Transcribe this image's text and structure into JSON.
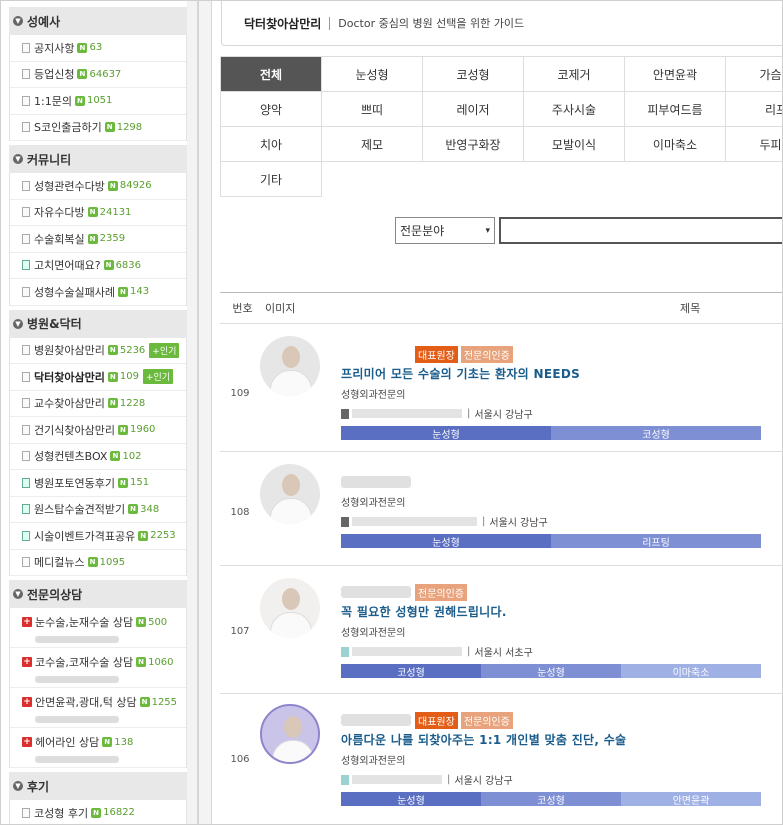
{
  "sidebar": {
    "sections": [
      {
        "title": "성예사",
        "items": [
          {
            "label": "공지사항",
            "count": "63"
          },
          {
            "label": "등업신청",
            "count": "64637"
          },
          {
            "label": "1:1문의",
            "count": "1051"
          },
          {
            "label": "S코인출금하기",
            "count": "1298"
          }
        ]
      },
      {
        "title": "커뮤니티",
        "items": [
          {
            "label": "성형관련수다방",
            "count": "84926"
          },
          {
            "label": "자유수다방",
            "count": "24131"
          },
          {
            "label": "수술회복실",
            "count": "2359"
          },
          {
            "label": "고치면어때요?",
            "count": "6836"
          },
          {
            "label": "성형수술실패사례",
            "count": "143"
          }
        ]
      },
      {
        "title": "병원&닥터",
        "items": [
          {
            "label": "병원찾아삼만리",
            "count": "5236",
            "hot": "+인기"
          },
          {
            "label": "닥터찾아삼만리",
            "count": "109",
            "hot": "+인기"
          },
          {
            "label": "교수찾아삼만리",
            "count": "1228"
          },
          {
            "label": "건기식찾아삼만리",
            "count": "1960"
          },
          {
            "label": "성형컨텐츠BOX",
            "count": "102"
          },
          {
            "label": "병원포토연동후기",
            "count": "151"
          },
          {
            "label": "원스탑수술견적받기",
            "count": "348"
          },
          {
            "label": "시술이벤트가격표공유",
            "count": "2253"
          },
          {
            "label": "메디컬뉴스",
            "count": "1095"
          }
        ]
      },
      {
        "title": "전문의상담",
        "items": [
          {
            "label": "눈수술,눈재수술 상담",
            "count": "500"
          },
          {
            "label": "코수술,코재수술 상담",
            "count": "1060"
          },
          {
            "label": "안면윤곽,광대,턱 상담",
            "count": "1255"
          },
          {
            "label": "헤어라인 상담",
            "count": "138"
          }
        ]
      },
      {
        "title": "후기",
        "items": [
          {
            "label": "코성형 후기",
            "count": "16822"
          }
        ]
      }
    ]
  },
  "header": {
    "title": "닥터찾아삼만리",
    "subtitle": "Doctor 중심의 병원 선택을 위한 가이드"
  },
  "categories": [
    "전체",
    "눈성형",
    "코성형",
    "코제거",
    "안면윤곽",
    "가슴성",
    "양악",
    "쁘띠",
    "레이저",
    "주사시술",
    "피부여드름",
    "리프",
    "치아",
    "제모",
    "반영구화장",
    "모발이식",
    "이마축소",
    "두피문",
    "기타"
  ],
  "search": {
    "select_value": "전문분야",
    "arrow": "▾"
  },
  "table_header": {
    "num": "번호",
    "image": "이미지",
    "title": "제목"
  },
  "rows": [
    {
      "num": "109",
      "tags": [
        "대표원장",
        "전문의인증"
      ],
      "title": "프리미어 모든 수술의 기초는 환자의 NEEDS",
      "dept": "성형외과전문의",
      "location": "서울시 강남구",
      "specialties": [
        "눈성형",
        "코성형"
      ]
    },
    {
      "num": "108",
      "tags": [],
      "title": "",
      "dept": "성형외과전문의",
      "location": "서울시 강남구",
      "specialties": [
        "눈성형",
        "리프팅"
      ]
    },
    {
      "num": "107",
      "tags": [
        "전문의인증"
      ],
      "title": "꼭 필요한 성형만 권해드립니다.",
      "dept": "성형외과전문의",
      "location": "서울시 서초구",
      "specialties": [
        "코성형",
        "눈성형",
        "이마축소"
      ]
    },
    {
      "num": "106",
      "tags": [
        "대표원장",
        "전문의인증"
      ],
      "title": "아름다운 나를 되찾아주는 1:1 개인별 맞춤 진단, 수술",
      "dept": "성형외과전문의",
      "location": "서울시 강남구",
      "specialties": [
        "눈성형",
        "코성형",
        "안면윤곽"
      ]
    }
  ],
  "colors": {
    "accent_tag": "#e35d16",
    "spec_tag": "#e8a37d",
    "count_green": "#6bb93d",
    "title_blue": "#1a5c8c",
    "bar_primary": "#5a6ec2"
  },
  "icons": {
    "section_toggle": "chevron-down-icon",
    "doc": "document-icon",
    "new": "new-badge-icon",
    "consult": "plus-icon"
  }
}
